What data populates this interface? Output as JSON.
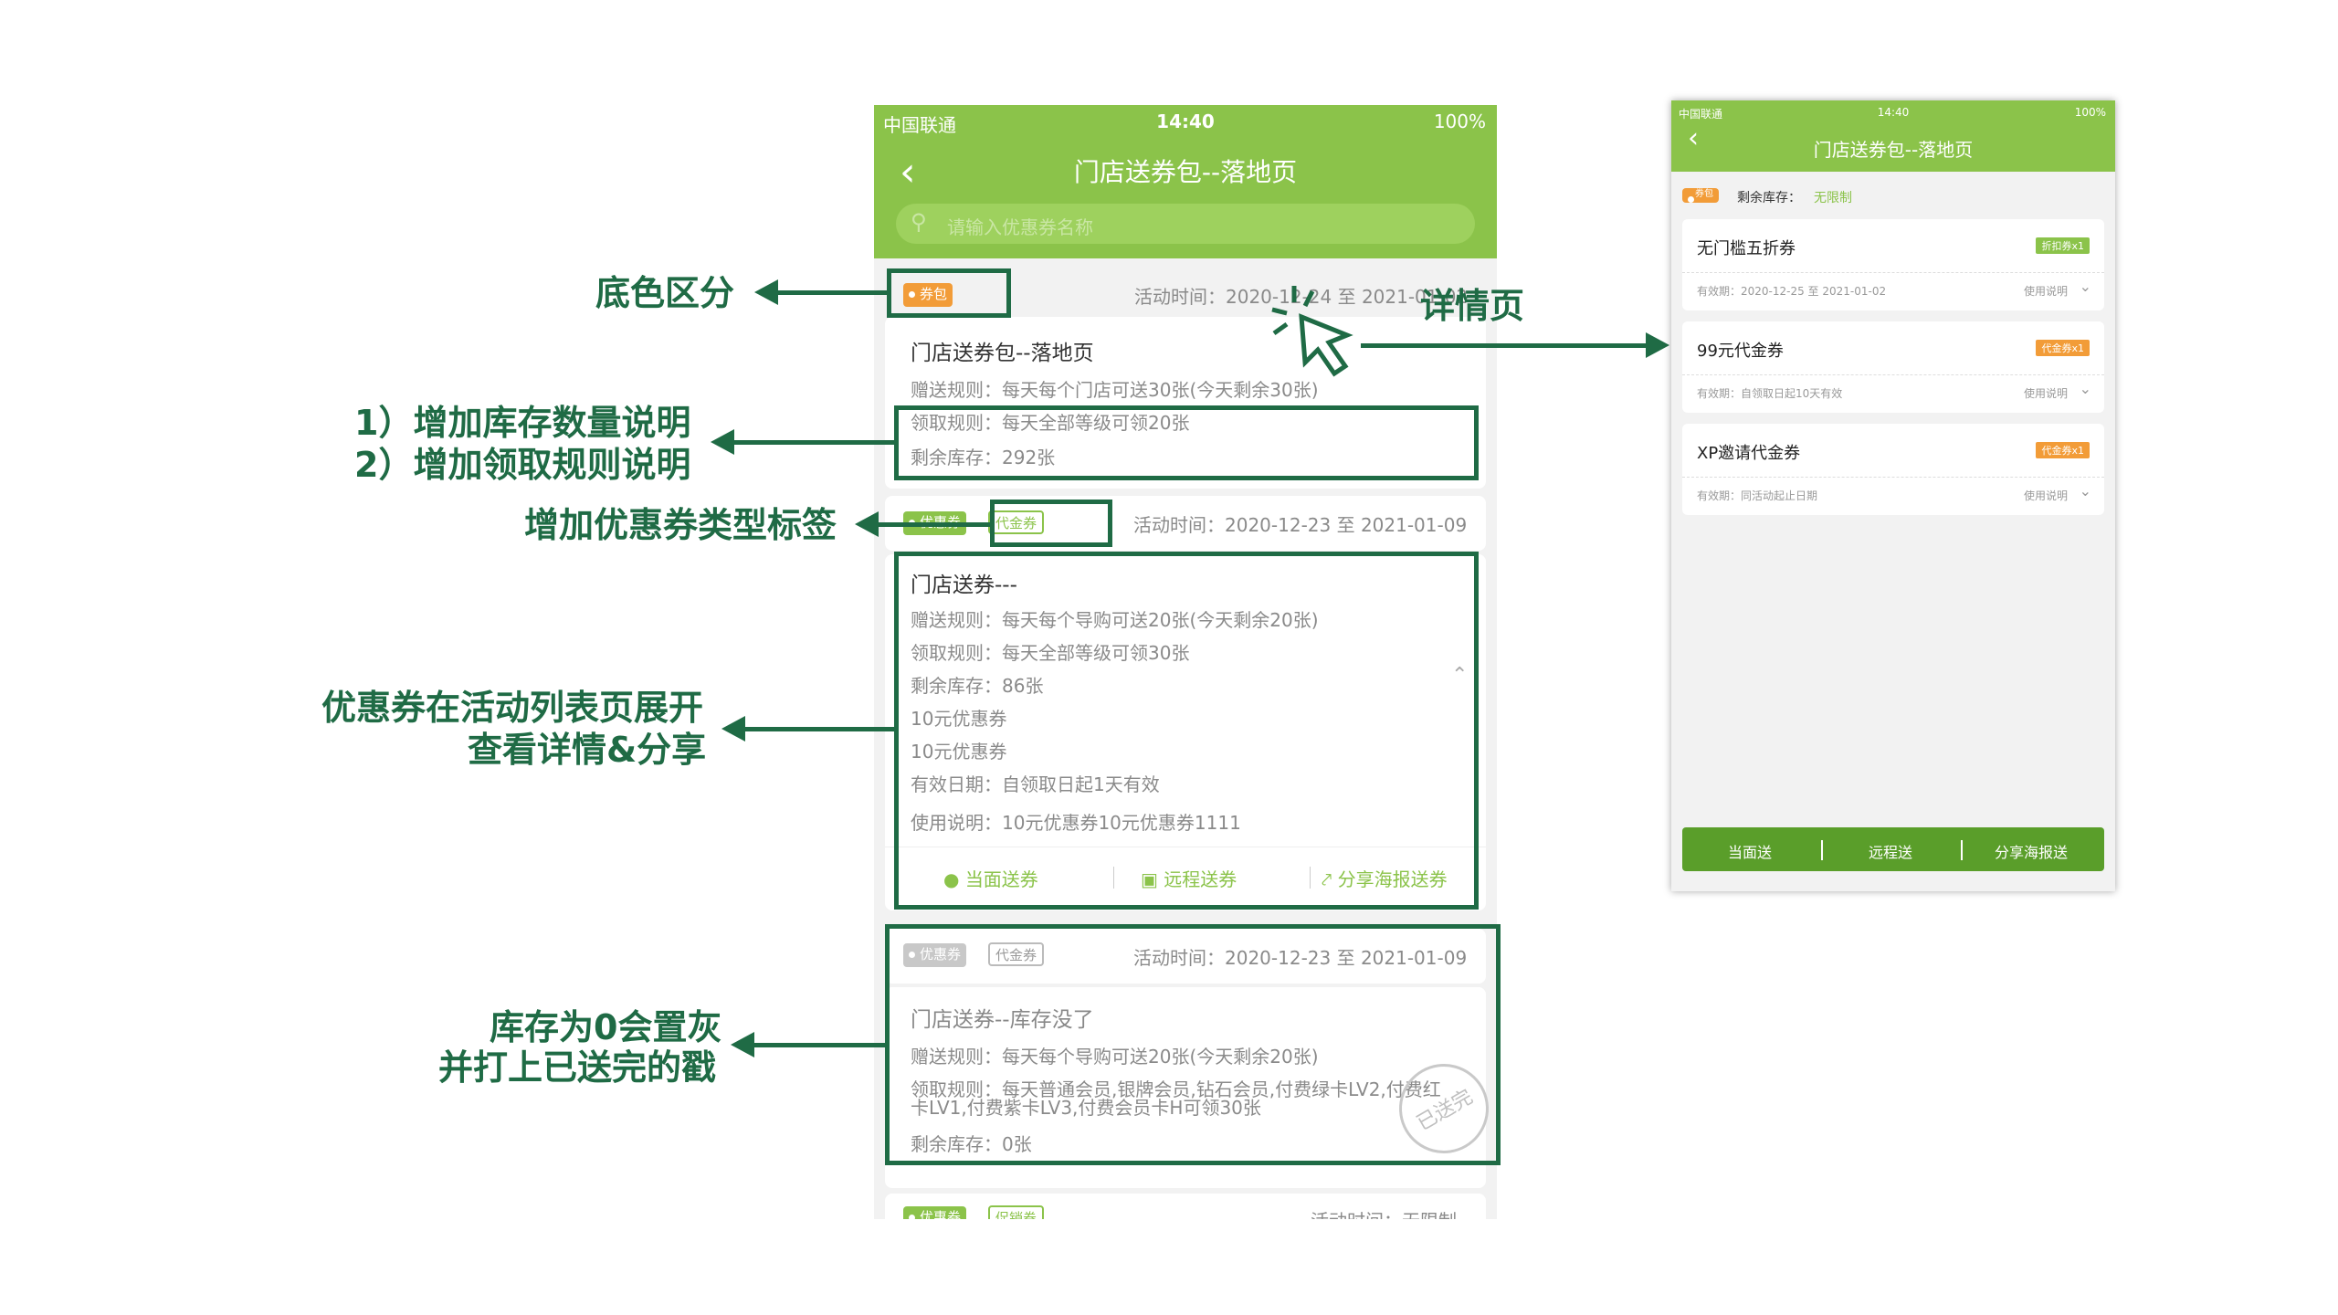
{
  "annotations": {
    "bg_color": "底色区分",
    "stock_rule_1": "1）增加库存数量说明",
    "stock_rule_2": "2）增加领取规则说明",
    "coupon_tag": "增加优惠券类型标签",
    "expand_1": "优惠券在活动列表页展开",
    "expand_2": "查看详情&分享",
    "zero_1": "库存为0会置灰",
    "zero_2": "并打上已送完的戳",
    "detail_page": "详情页"
  },
  "left_phone": {
    "status": {
      "carrier": "中国联通",
      "time": "14:40",
      "battery": "100%"
    },
    "title": "门店送券包--落地页",
    "search_placeholder": "请输入优惠券名称",
    "card1": {
      "tag": "券包",
      "time": "活动时间：2020-12-24 至 2021-01-02",
      "name": "门店送券包--落地页",
      "gift_rule": "赠送规则：每天每个门店可送30张(今天剩余30张)",
      "receive_rule": "领取规则：每天全部等级可领20张",
      "stock": "剩余库存：292张"
    },
    "card2": {
      "tag": "优惠券",
      "type_tag": "代金券",
      "time": "活动时间：2020-12-23 至 2021-01-09",
      "name": "门店送券---",
      "gift_rule": "赠送规则：每天每个导购可送20张(今天剩余20张)",
      "receive_rule": "领取规则：每天全部等级可领30张",
      "stock": "剩余库存：86张",
      "coupon1": "10元优惠券",
      "coupon2": "10元优惠券",
      "valid": "有效日期：自领取日起1天有效",
      "usage": "使用说明：10元优惠券10元优惠券1111",
      "action1": "当面送券",
      "action2": "远程送券",
      "action3": "分享海报送券"
    },
    "card3": {
      "tag": "优惠券",
      "type_tag": "代金券",
      "time": "活动时间：2020-12-23 至 2021-01-09",
      "name": "门店送券--库存没了",
      "gift_rule": "赠送规则：每天每个导购可送20张(今天剩余20张)",
      "receive_rule_1": "领取规则：每天普通会员,银牌会员,钻石会员,付费绿卡LV2,付费红",
      "receive_rule_2": "卡LV1,付费紫卡LV3,付费会员卡H可领30张",
      "stock": "剩余库存：0张",
      "stamp": "已送完"
    },
    "card4": {
      "tag": "优惠券",
      "type_tag": "促销券",
      "time": "活动时间：无限制"
    }
  },
  "right_phone": {
    "status": {
      "carrier": "中国联通",
      "time": "14:40",
      "battery": "100%"
    },
    "title": "门店送券包--落地页",
    "tag": "券包",
    "stock_label": "剩余库存：",
    "stock_value": "无限制",
    "items": [
      {
        "name": "无门槛五折券",
        "badge": "折扣券x1",
        "validity": "有效期：2020-12-25 至 2021-01-02",
        "usage": "使用说明"
      },
      {
        "name": "99元代金券",
        "badge": "代金券x1",
        "validity": "有效期：自领取日起10天有效",
        "usage": "使用说明"
      },
      {
        "name": "XP邀请代金券",
        "badge": "代金券x1",
        "validity": "有效期：同活动起止日期",
        "usage": "使用说明"
      }
    ],
    "btn1": "当面送",
    "btn2": "远程送",
    "btn3": "分享海报送"
  },
  "colors": {
    "brand_green": "#8bc34a",
    "annotation_green": "#1f6b45",
    "tag_orange": "#f29c38"
  }
}
